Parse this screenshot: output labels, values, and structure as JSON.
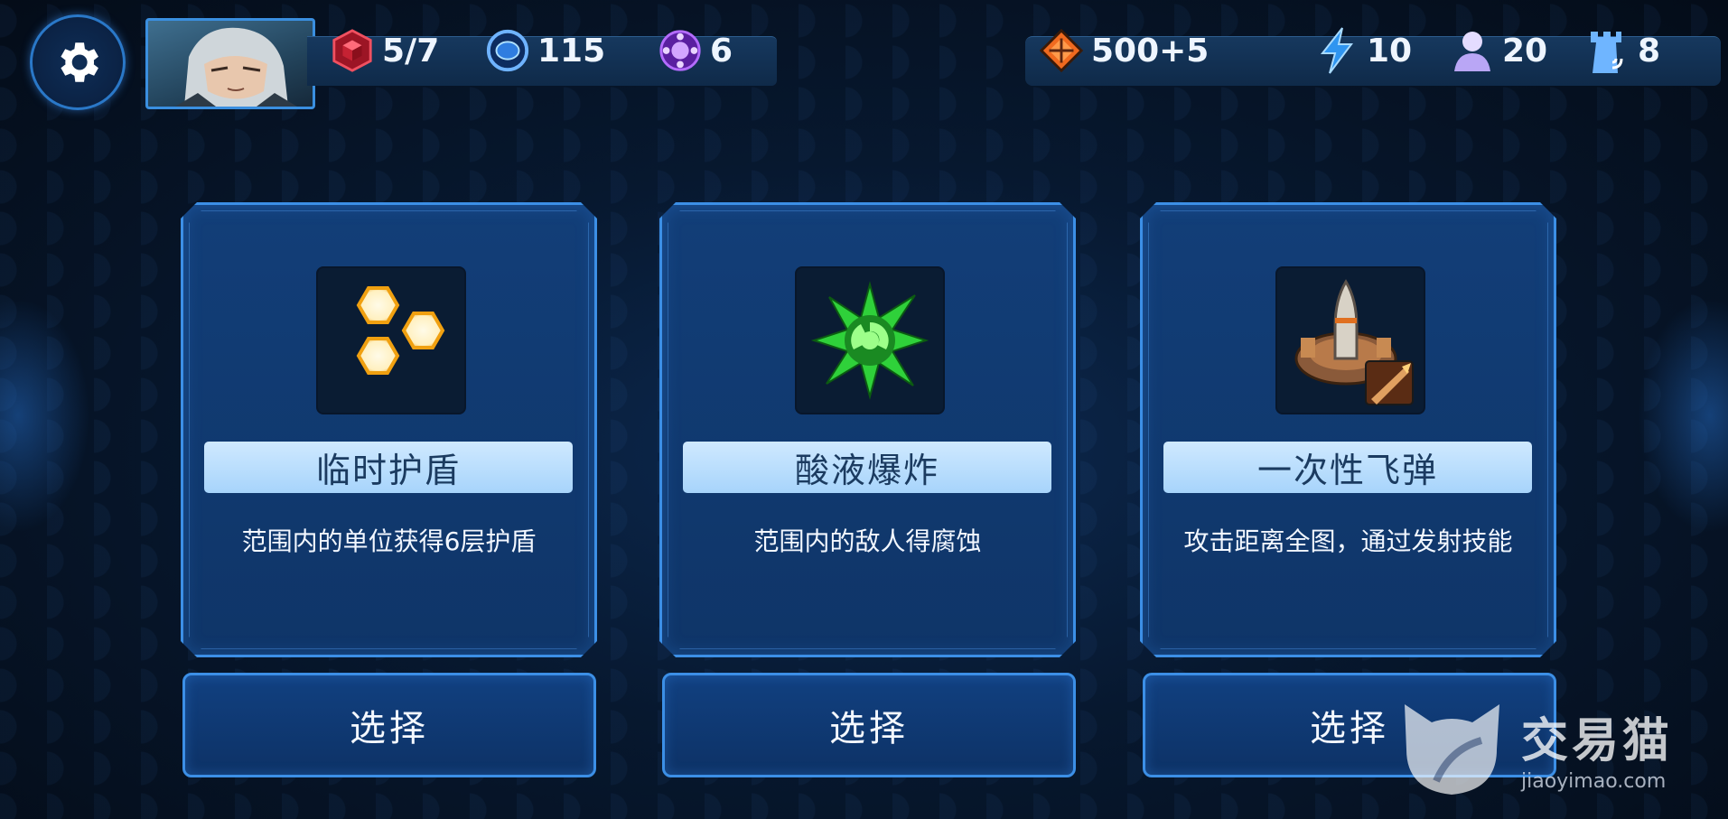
{
  "header": {
    "settings_icon": "gear-icon",
    "avatar_icon": "commander-portrait",
    "left_resources": [
      {
        "icon": "red-cube-icon",
        "value": "5/7",
        "color": "#d6283a"
      },
      {
        "icon": "blue-orb-icon",
        "value": "115",
        "color": "#3b8de8"
      },
      {
        "icon": "purple-token-icon",
        "value": "6",
        "color": "#8a3ad6"
      }
    ],
    "right_resources": [
      {
        "icon": "orange-crystal-icon",
        "value": "500+5",
        "color": "#f06a1f"
      },
      {
        "icon": "lightning-icon",
        "value": "10",
        "color": "#3fa5ff"
      },
      {
        "icon": "population-icon",
        "value": "20",
        "color": "#c8b8f5"
      },
      {
        "icon": "tower-signal-icon",
        "value": "8",
        "color": "#6fb5ff"
      }
    ]
  },
  "cards": [
    {
      "icon": "hexagon-shield-icon",
      "name": "临时护盾",
      "description": "范围内的单位获得6层护盾",
      "button": "选择"
    },
    {
      "icon": "acid-burst-icon",
      "name": "酸液爆炸",
      "description": "范围内的敌人得腐蚀",
      "button": "选择"
    },
    {
      "icon": "missile-launcher-icon",
      "name": "一次性飞弹",
      "description": "攻击距离全图，通过发射技能",
      "button": "选择"
    }
  ],
  "watermark": {
    "title": "交易猫",
    "url": "jiaoyimao.com",
    "icon": "cat-logo-icon"
  },
  "colors": {
    "accent": "#3c8fe6",
    "card_bg": "#123e78",
    "name_bar": "#cfe9ff"
  }
}
